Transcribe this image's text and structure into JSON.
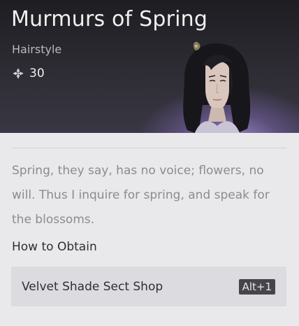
{
  "item": {
    "name": "Murmurs of Spring",
    "type": "Hairstyle",
    "price": "30",
    "price_icon": "sect-currency-icon",
    "description": "Spring, they say, has no voice; flowers, no will. Thus I inquire for spring, and speak for the blossoms."
  },
  "obtain": {
    "heading": "How to Obtain",
    "sources": [
      {
        "label": "Velvet Shade Sect Shop",
        "hotkey": "Alt+1"
      }
    ]
  },
  "colors": {
    "header_bg": "#2b2a31",
    "header_glow": "#a996d7",
    "panel_bg": "#e9e9ec",
    "row_bg": "#dcdce0",
    "hotkey_bg": "#45454b"
  }
}
